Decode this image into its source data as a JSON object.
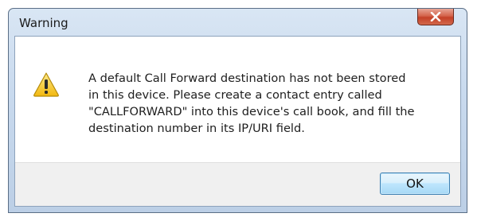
{
  "window": {
    "title": "Warning"
  },
  "message": {
    "lines": [
      "A default Call Forward destination has not been stored",
      "in this device. Please create a contact entry called",
      "\"CALLFORWARD\" into this device's call book, and fill the",
      "destination number in its IP/URI field."
    ]
  },
  "buttons": {
    "ok_label": "OK"
  },
  "icons": {
    "close": "close-icon",
    "warning": "warning-icon"
  },
  "colors": {
    "close_button": "#c44128",
    "warning_triangle": "#f2c21b",
    "ok_button_border": "#3c7fb1"
  }
}
